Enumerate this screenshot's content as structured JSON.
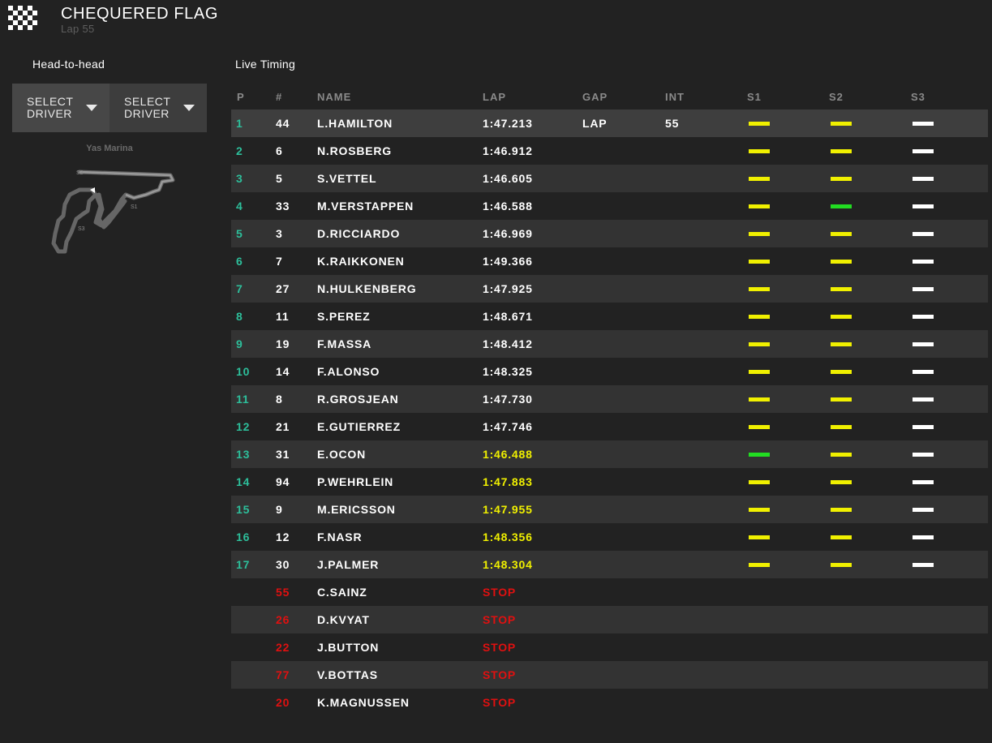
{
  "header": {
    "flag_icon": "chequered-flag-icon",
    "title": "CHEQUERED FLAG",
    "subtitle": "Lap 55"
  },
  "head_to_head": {
    "title": "Head-to-head",
    "select1": {
      "line1": "SELECT",
      "line2": "DRIVER"
    },
    "select2": {
      "line1": "SELECT",
      "line2": "DRIVER"
    }
  },
  "track": {
    "name": "Yas Marina",
    "sector_labels": [
      "S1",
      "S2",
      "S3"
    ]
  },
  "live_timing": {
    "title": "Live Timing",
    "columns": [
      "P",
      "#",
      "NAME",
      "LAP",
      "GAP",
      "INT",
      "S1",
      "S2",
      "S3"
    ],
    "colors": {
      "position": "#2dbf9b",
      "sector_yellow": "#f0f000",
      "sector_green": "#22dd22",
      "sector_white": "#ffffff",
      "stop_red": "#e01010",
      "lap_yellow": "#f0f000"
    },
    "rows": [
      {
        "p": "1",
        "num": "44",
        "name": "L.HAMILTON",
        "lap": "1:47.213",
        "gap": "LAP",
        "int": "55",
        "s1": "yellow",
        "s2": "yellow",
        "s3": "white",
        "lap_color": "white"
      },
      {
        "p": "2",
        "num": "6",
        "name": "N.ROSBERG",
        "lap": "1:46.912",
        "gap": "",
        "int": "",
        "s1": "yellow",
        "s2": "yellow",
        "s3": "white",
        "lap_color": "white"
      },
      {
        "p": "3",
        "num": "5",
        "name": "S.VETTEL",
        "lap": "1:46.605",
        "gap": "",
        "int": "",
        "s1": "yellow",
        "s2": "yellow",
        "s3": "white",
        "lap_color": "white"
      },
      {
        "p": "4",
        "num": "33",
        "name": "M.VERSTAPPEN",
        "lap": "1:46.588",
        "gap": "",
        "int": "",
        "s1": "yellow",
        "s2": "green",
        "s3": "white",
        "lap_color": "white"
      },
      {
        "p": "5",
        "num": "3",
        "name": "D.RICCIARDO",
        "lap": "1:46.969",
        "gap": "",
        "int": "",
        "s1": "yellow",
        "s2": "yellow",
        "s3": "white",
        "lap_color": "white"
      },
      {
        "p": "6",
        "num": "7",
        "name": "K.RAIKKONEN",
        "lap": "1:49.366",
        "gap": "",
        "int": "",
        "s1": "yellow",
        "s2": "yellow",
        "s3": "white",
        "lap_color": "white"
      },
      {
        "p": "7",
        "num": "27",
        "name": "N.HULKENBERG",
        "lap": "1:47.925",
        "gap": "",
        "int": "",
        "s1": "yellow",
        "s2": "yellow",
        "s3": "white",
        "lap_color": "white"
      },
      {
        "p": "8",
        "num": "11",
        "name": "S.PEREZ",
        "lap": "1:48.671",
        "gap": "",
        "int": "",
        "s1": "yellow",
        "s2": "yellow",
        "s3": "white",
        "lap_color": "white"
      },
      {
        "p": "9",
        "num": "19",
        "name": "F.MASSA",
        "lap": "1:48.412",
        "gap": "",
        "int": "",
        "s1": "yellow",
        "s2": "yellow",
        "s3": "white",
        "lap_color": "white"
      },
      {
        "p": "10",
        "num": "14",
        "name": "F.ALONSO",
        "lap": "1:48.325",
        "gap": "",
        "int": "",
        "s1": "yellow",
        "s2": "yellow",
        "s3": "white",
        "lap_color": "white"
      },
      {
        "p": "11",
        "num": "8",
        "name": "R.GROSJEAN",
        "lap": "1:47.730",
        "gap": "",
        "int": "",
        "s1": "yellow",
        "s2": "yellow",
        "s3": "white",
        "lap_color": "white"
      },
      {
        "p": "12",
        "num": "21",
        "name": "E.GUTIERREZ",
        "lap": "1:47.746",
        "gap": "",
        "int": "",
        "s1": "yellow",
        "s2": "yellow",
        "s3": "white",
        "lap_color": "white"
      },
      {
        "p": "13",
        "num": "31",
        "name": "E.OCON",
        "lap": "1:46.488",
        "gap": "",
        "int": "",
        "s1": "green",
        "s2": "yellow",
        "s3": "white",
        "lap_color": "yellow"
      },
      {
        "p": "14",
        "num": "94",
        "name": "P.WEHRLEIN",
        "lap": "1:47.883",
        "gap": "",
        "int": "",
        "s1": "yellow",
        "s2": "yellow",
        "s3": "white",
        "lap_color": "yellow"
      },
      {
        "p": "15",
        "num": "9",
        "name": "M.ERICSSON",
        "lap": "1:47.955",
        "gap": "",
        "int": "",
        "s1": "yellow",
        "s2": "yellow",
        "s3": "white",
        "lap_color": "yellow"
      },
      {
        "p": "16",
        "num": "12",
        "name": "F.NASR",
        "lap": "1:48.356",
        "gap": "",
        "int": "",
        "s1": "yellow",
        "s2": "yellow",
        "s3": "white",
        "lap_color": "yellow"
      },
      {
        "p": "17",
        "num": "30",
        "name": "J.PALMER",
        "lap": "1:48.304",
        "gap": "",
        "int": "",
        "s1": "yellow",
        "s2": "yellow",
        "s3": "white",
        "lap_color": "yellow"
      },
      {
        "p": "",
        "num": "55",
        "name": "C.SAINZ",
        "lap": "STOP",
        "gap": "",
        "int": "",
        "s1": "",
        "s2": "",
        "s3": "",
        "lap_color": "red",
        "num_color": "red"
      },
      {
        "p": "",
        "num": "26",
        "name": "D.KVYAT",
        "lap": "STOP",
        "gap": "",
        "int": "",
        "s1": "",
        "s2": "",
        "s3": "",
        "lap_color": "red",
        "num_color": "red"
      },
      {
        "p": "",
        "num": "22",
        "name": "J.BUTTON",
        "lap": "STOP",
        "gap": "",
        "int": "",
        "s1": "",
        "s2": "",
        "s3": "",
        "lap_color": "red",
        "num_color": "red"
      },
      {
        "p": "",
        "num": "77",
        "name": "V.BOTTAS",
        "lap": "STOP",
        "gap": "",
        "int": "",
        "s1": "",
        "s2": "",
        "s3": "",
        "lap_color": "red",
        "num_color": "red"
      },
      {
        "p": "",
        "num": "20",
        "name": "K.MAGNUSSEN",
        "lap": "STOP",
        "gap": "",
        "int": "",
        "s1": "",
        "s2": "",
        "s3": "",
        "lap_color": "red",
        "num_color": "red"
      }
    ]
  }
}
